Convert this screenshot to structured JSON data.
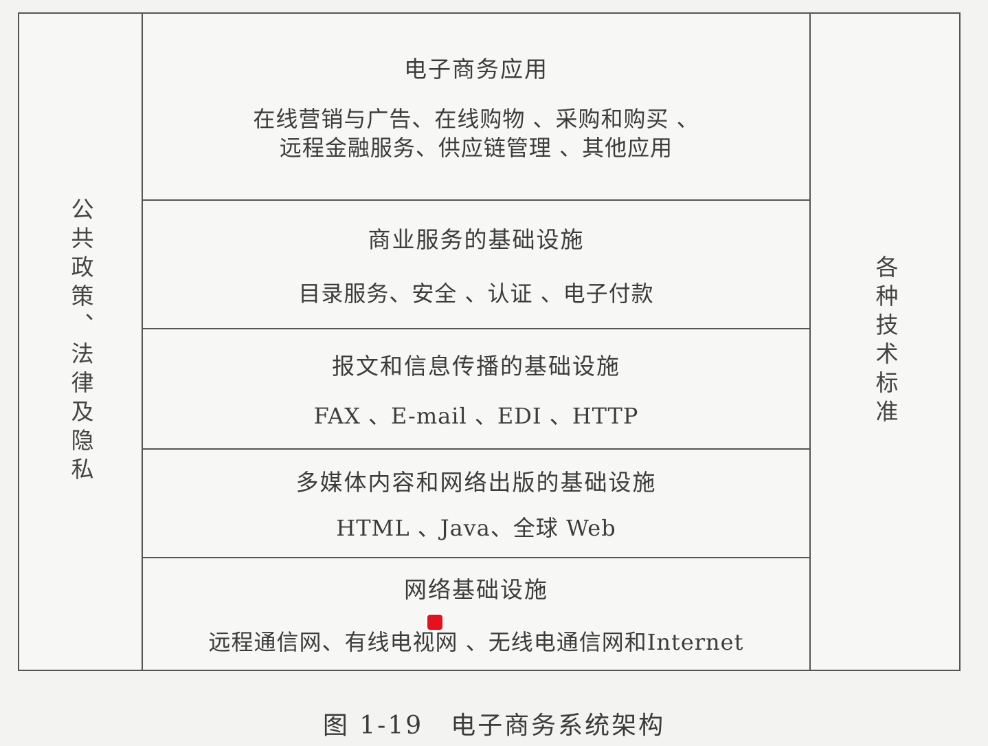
{
  "left_side": {
    "label": "公共政策、法律及隐私"
  },
  "right_side": {
    "label": "各种技术标准"
  },
  "layers": [
    {
      "title": "电子商务应用",
      "items": "在线营销与广告、在线购物 、采购和购买 、\n远程金融服务、供应链管理 、其他应用"
    },
    {
      "title": "商业服务的基础设施",
      "items": "目录服务、安全 、认证 、电子付款"
    },
    {
      "title": "报文和信息传播的基础设施",
      "items": "FAX 、E-mail 、EDI 、HTTP"
    },
    {
      "title": "多媒体内容和网络出版的基础设施",
      "items": "HTML 、Java、全球 Web"
    },
    {
      "title": "网络基础设施",
      "items": "远程通信网、有线电视网 、无线电通信网和Internet"
    }
  ],
  "caption": {
    "number": "图 1-19",
    "title": "电子商务系统架构"
  },
  "colors": {
    "pointer_highlight": "#faee00",
    "pointer_dot": "#e8101a"
  }
}
